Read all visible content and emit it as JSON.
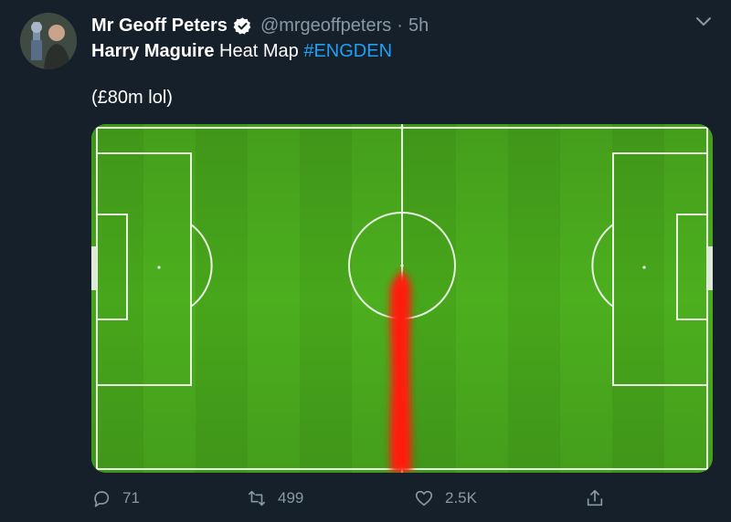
{
  "tweet": {
    "author": {
      "display_name": "Mr Geoff Peters",
      "handle": "@mrgeoffpeters",
      "verified": true
    },
    "separator": "·",
    "time": "5h",
    "text": {
      "subject": "Harry Maguire",
      "phrase": " Heat Map ",
      "hashtag": "#ENGDEN",
      "second_line": "(£80m lol)"
    },
    "media": {
      "kind": "heat map on football pitch",
      "pitch_color": "#4caf1e",
      "heat_color": "#ff1a0a"
    },
    "actions": {
      "reply_count": "71",
      "retweet_count": "499",
      "like_count": "2.5K"
    },
    "icons": {
      "more": "chevron-down-icon",
      "reply": "speech-bubble-icon",
      "retweet": "retweet-arrows-icon",
      "like": "heart-icon",
      "share": "share-upload-icon",
      "verified": "verified-badge-icon"
    },
    "colors": {
      "background": "#15202b",
      "secondary_text": "#8899a6",
      "link": "#1da1f2"
    }
  }
}
